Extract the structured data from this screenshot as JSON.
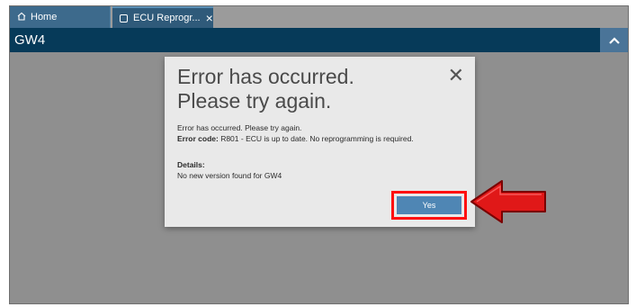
{
  "tabs": [
    {
      "label": "Home",
      "icon": "home-icon"
    },
    {
      "label": "ECU Reprogr...",
      "icon": "window-icon"
    }
  ],
  "header": {
    "title": "GW4"
  },
  "dialog": {
    "title_line1": "Error has occurred.",
    "title_line2": "Please try again.",
    "message": "Error has occurred. Please try again.",
    "error_code_label": "Error code:",
    "error_code_text": " R801 - ECU is up to date. No reprogramming is required.",
    "details_label": "Details:",
    "details_text": "No new version found for GW4",
    "yes_label": "Yes"
  },
  "colors": {
    "header_bg": "#063a59",
    "backdrop": "#8f8f8f",
    "dialog_bg": "#e9e9e9",
    "button_bg": "#4f86b4",
    "highlight": "#ff1010"
  }
}
